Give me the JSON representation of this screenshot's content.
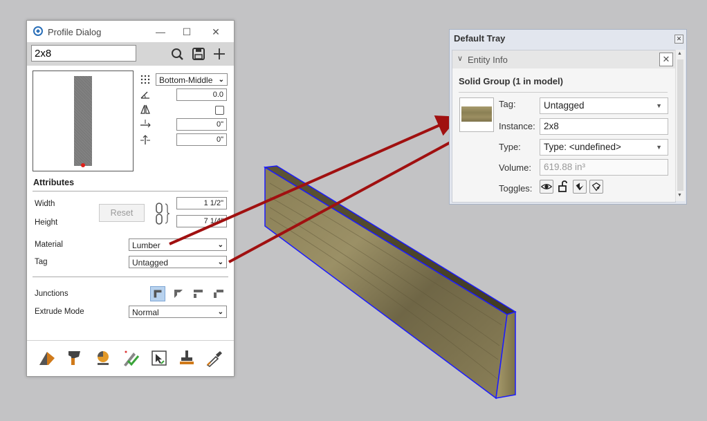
{
  "profile_dialog": {
    "title": "Profile Dialog",
    "name_value": "2x8",
    "anchor_option": "Bottom-Middle",
    "rotation_value": "0.0",
    "offset_x_value": "0\"",
    "offset_y_value": "0\"",
    "attributes_title": "Attributes",
    "width_label": "Width",
    "height_label": "Height",
    "width_value": "1 1/2\"",
    "height_value": "7 1/4\"",
    "reset_label": "Reset",
    "material_label": "Material",
    "material_value": "Lumber",
    "tag_label": "Tag",
    "tag_value": "Untagged",
    "junctions_label": "Junctions",
    "extrude_label": "Extrude Mode",
    "extrude_value": "Normal"
  },
  "default_tray": {
    "title": "Default Tray",
    "panel_title": "Entity Info",
    "subtitle": "Solid Group (1 in model)",
    "tag_label": "Tag:",
    "tag_value": "Untagged",
    "instance_label": "Instance:",
    "instance_value": "2x8",
    "type_label": "Type:",
    "type_value": "Type: <undefined>",
    "volume_label": "Volume:",
    "volume_value": "619.88 in³",
    "toggles_label": "Toggles:"
  },
  "colors": {
    "background": "#c3c3c5",
    "arrow": "#a01010",
    "edge_highlight": "#1a1aff",
    "wood": "#7e7350"
  }
}
